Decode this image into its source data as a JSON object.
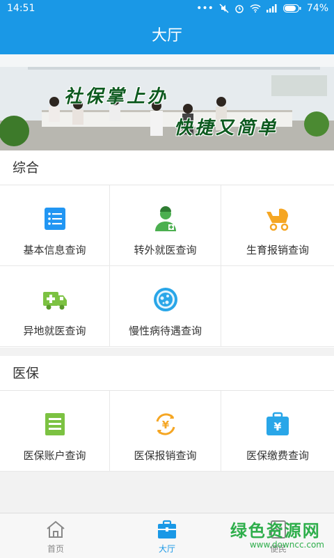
{
  "status": {
    "time": "14:51",
    "battery": "74%"
  },
  "header": {
    "title": "大厅"
  },
  "banner": {
    "slogan1": "社保掌上办",
    "slogan2": "快捷又简单"
  },
  "sections": [
    {
      "title": "综合",
      "items": [
        {
          "label": "基本信息查询",
          "icon": "list-icon",
          "color": "#2196f3"
        },
        {
          "label": "转外就医查询",
          "icon": "doctor-icon",
          "color": "#4caf50"
        },
        {
          "label": "生育报销查询",
          "icon": "stroller-icon",
          "color": "#f5a623"
        },
        {
          "label": "异地就医查询",
          "icon": "ambulance-icon",
          "color": "#7cc242"
        },
        {
          "label": "慢性病待遇查询",
          "icon": "cell-icon",
          "color": "#29a6e8"
        }
      ]
    },
    {
      "title": "医保",
      "items": [
        {
          "label": "医保账户查询",
          "icon": "account-book-icon",
          "color": "#7cc242"
        },
        {
          "label": "医保报销查询",
          "icon": "yuan-refresh-icon",
          "color": "#f5a623"
        },
        {
          "label": "医保缴费查询",
          "icon": "yuan-bag-icon",
          "color": "#29a6e8"
        }
      ]
    }
  ],
  "tabs": [
    {
      "label": "首页",
      "icon": "home-icon"
    },
    {
      "label": "大厅",
      "icon": "briefcase-icon",
      "active": true
    },
    {
      "label": "便民",
      "icon": "convenience-icon"
    }
  ],
  "watermark": {
    "line1": "绿色资源网",
    "line2": "www.downcc.com"
  },
  "colors": {
    "primary": "#1a98e6",
    "green": "#7cc242",
    "orange": "#f5a623",
    "blue": "#29a6e8"
  }
}
